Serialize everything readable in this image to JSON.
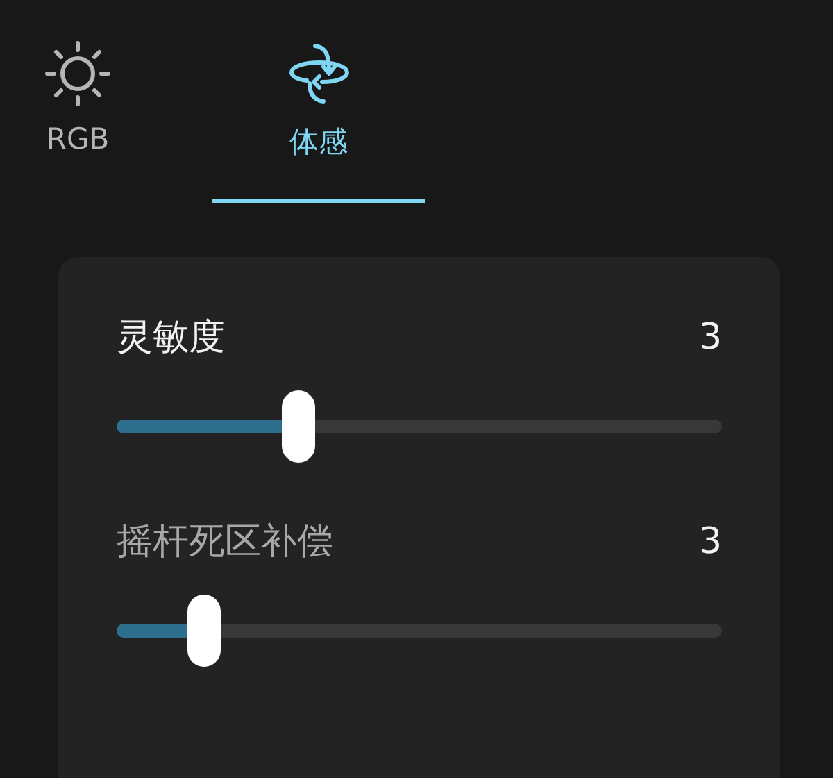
{
  "tabs": [
    {
      "label": "RGB",
      "kind": "sun",
      "selected": false
    },
    {
      "label": "体感",
      "kind": "rotate",
      "selected": true
    }
  ],
  "settings": [
    {
      "label": "灵敏度",
      "value": "3",
      "level": 0.3,
      "disabled": false
    },
    {
      "label": "摇杆死区补偿",
      "value": "3",
      "level": 0.144,
      "disabled": true
    }
  ]
}
